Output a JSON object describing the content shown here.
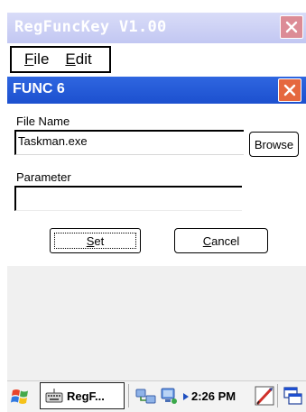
{
  "window": {
    "title": "RegFuncKey  V1.00"
  },
  "menu": {
    "items": [
      {
        "label": "File",
        "accel": "F",
        "rest": "ile"
      },
      {
        "label": "Edit",
        "accel": "E",
        "rest": "dit"
      }
    ]
  },
  "dialog": {
    "title": "FUNC 6",
    "file_name_label": "File Name",
    "file_name_value": "Taskman.exe",
    "browse_label": "Browse",
    "parameter_label": "Parameter",
    "parameter_value": "",
    "set_button": {
      "label": "Set",
      "accel": "S",
      "rest": "et"
    },
    "cancel_button": {
      "label": "Cancel",
      "accel": "C",
      "rest": "ancel"
    }
  },
  "taskbar": {
    "task_label": "RegF...",
    "time": "2:26 PM"
  },
  "colors": {
    "dialog_title_blue": "#2f66e0",
    "close_orange": "#e5683f",
    "inactive_title": "#c2c7f2"
  },
  "icons": [
    "windows-start-icon",
    "keyboard-icon",
    "network-icon",
    "connection-icon",
    "arrow-right-icon",
    "pen-icon",
    "windows-switch-icon",
    "close-icon"
  ]
}
